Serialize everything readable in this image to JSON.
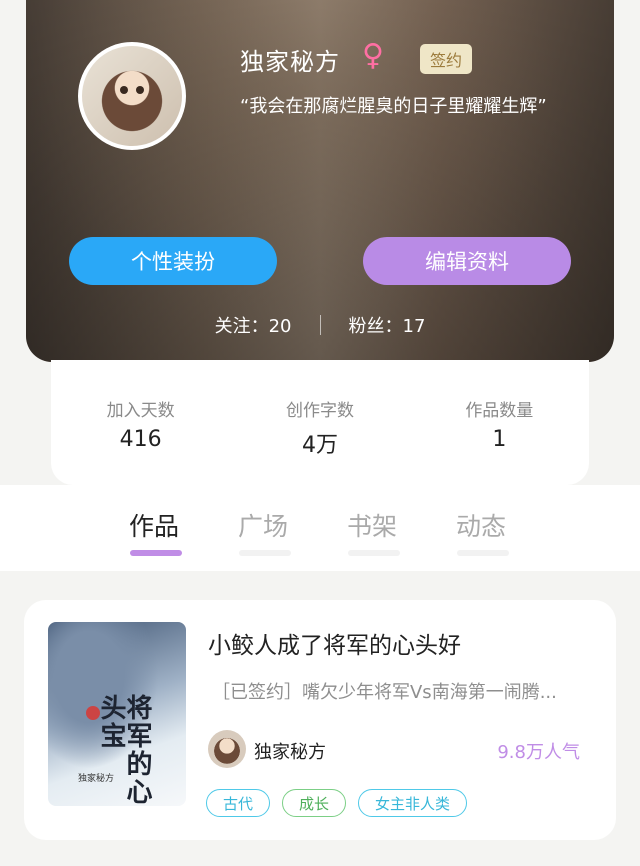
{
  "profile": {
    "username": "独家秘方",
    "gender_icon": "♀",
    "badge": "签约",
    "quote": "“我会在那腐烂腥臭的日子里耀耀生辉”",
    "btn_dressup": "个性装扮",
    "btn_edit": "编辑资料",
    "follow_label": "关注：20",
    "fans_label": "粉丝：17"
  },
  "stats": [
    {
      "label": "加入天数",
      "value": "416"
    },
    {
      "label": "创作字数",
      "value": "4万"
    },
    {
      "label": "作品数量",
      "value": "1"
    }
  ],
  "tabs": [
    {
      "label": "作品",
      "active": true
    },
    {
      "label": "广场",
      "active": false
    },
    {
      "label": "书架",
      "active": false
    },
    {
      "label": "动态",
      "active": false
    }
  ],
  "book": {
    "title": "小鲛人成了将军的心头好",
    "description": "［已签约］嘴欠少年将军Vs南海第一闹腾...",
    "author": "独家秘方",
    "popularity": "9.8万人气",
    "cover_title": "将军的心头宝",
    "cover_author": "独家秘方",
    "tags": [
      "古代",
      "成长",
      "女主非人类"
    ]
  },
  "colors": {
    "accent_blue": "#2aa8f7",
    "accent_purple": "#b98be6",
    "gender_pink": "#ff6fa3"
  }
}
